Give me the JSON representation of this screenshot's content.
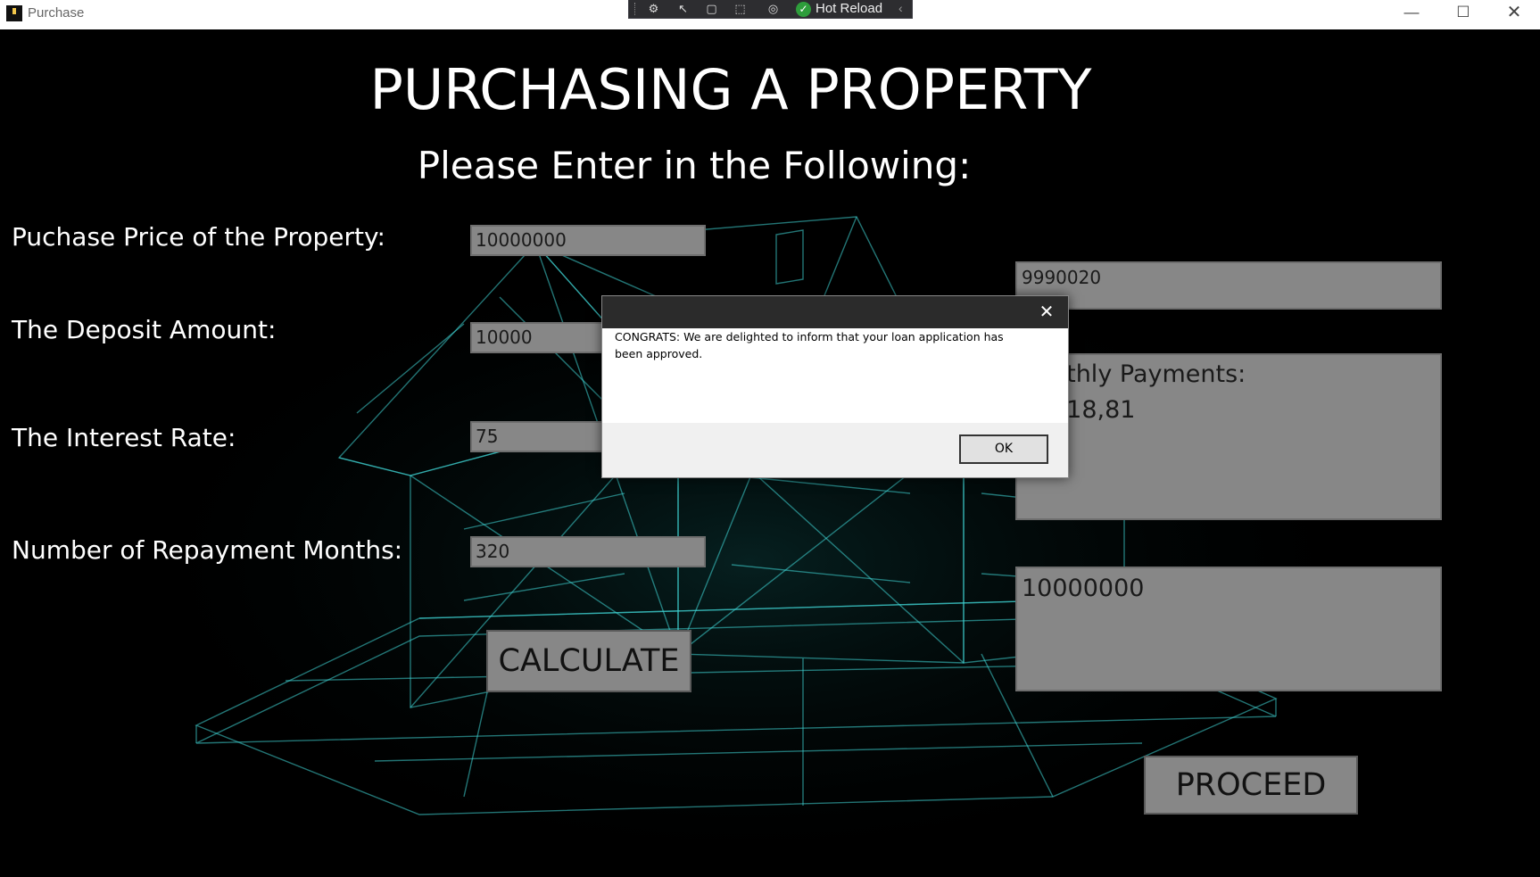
{
  "window": {
    "title": "Purchase",
    "controls": {
      "minimize": "—",
      "maximize": "☐",
      "close": "✕"
    }
  },
  "debug_toolbar": {
    "hot_reload_label": "Hot Reload",
    "icons": [
      "live-visual-tree-icon",
      "select-element-icon",
      "display-layout-adorners-icon",
      "track-focus-icon",
      "binding-failures-icon",
      "hot-reload-check-icon"
    ]
  },
  "page": {
    "title": "PURCHASING A PROPERTY",
    "subtitle": "Please Enter in the Following:",
    "fields": {
      "price_label": "Puchase Price of the Property:",
      "price_value": "10000000",
      "deposit_label": "The Deposit Amount:",
      "deposit_value": "10000",
      "interest_label": "The Interest Rate:",
      "interest_value": "75",
      "months_label": "Number of Repayment Months:",
      "months_value": "320"
    },
    "outputs": {
      "loan_amount": "9990020",
      "monthly_payments_label": "nthly Payments:",
      "monthly_payments_value": "218,81",
      "total_value": "10000000"
    },
    "buttons": {
      "calculate": "CALCULATE",
      "proceed": "PROCEED"
    }
  },
  "dialog": {
    "message": "CONGRATS: We are delighted to inform that your loan application has been approved.",
    "ok_label": "OK",
    "close_glyph": "✕"
  },
  "colors": {
    "background": "#000000",
    "wireframe": "#3fd6d6",
    "field_fill": "#878787",
    "dialog_title": "#2b2b2b"
  }
}
